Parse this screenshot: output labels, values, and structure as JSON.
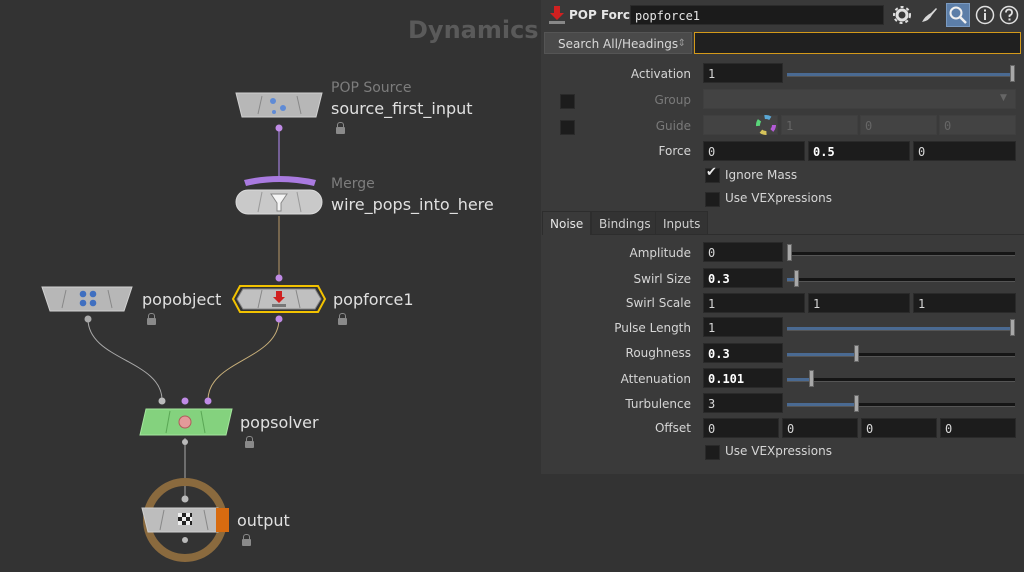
{
  "network": {
    "context_label": "Dynamics",
    "nodes": {
      "source": {
        "type": "POP Source",
        "name": "source_first_input"
      },
      "merge": {
        "type": "Merge",
        "name": "wire_pops_into_here"
      },
      "popobject": {
        "name": "popobject"
      },
      "popforce": {
        "name": "popforce1"
      },
      "popsolver": {
        "name": "popsolver"
      },
      "output": {
        "name": "output"
      }
    }
  },
  "panel": {
    "title": {
      "type_label": "POP Force",
      "node_name": "popforce1"
    },
    "search": {
      "label": "Search All/Headings",
      "value": ""
    },
    "params": {
      "activation": {
        "label": "Activation",
        "value": "1",
        "slider_fraction": 1.0
      },
      "group": {
        "label": "Group",
        "value": ""
      },
      "guide": {
        "label": "Guide",
        "values": [
          "1",
          "0",
          "0"
        ]
      },
      "force": {
        "label": "Force",
        "values": [
          "0",
          "0.5",
          "0"
        ]
      },
      "ignore_mass": {
        "label": "Ignore Mass",
        "checked": true
      },
      "use_vex_top": {
        "label": "Use VEXpressions",
        "checked": false
      }
    },
    "tabs": [
      "Noise",
      "Bindings",
      "Inputs"
    ],
    "noise": {
      "amplitude": {
        "label": "Amplitude",
        "value": "0",
        "slider_fraction": 0.0
      },
      "swirl_size": {
        "label": "Swirl Size",
        "value": "0.3",
        "slider_fraction": 0.03
      },
      "swirl_scale": {
        "label": "Swirl Scale",
        "values": [
          "1",
          "1",
          "1"
        ]
      },
      "pulse_length": {
        "label": "Pulse Length",
        "value": "1",
        "slider_fraction": 1.0
      },
      "roughness": {
        "label": "Roughness",
        "value": "0.3",
        "slider_fraction": 0.3
      },
      "attenuation": {
        "label": "Attenuation",
        "value": "0.101",
        "slider_fraction": 0.1
      },
      "turbulence": {
        "label": "Turbulence",
        "value": "3",
        "slider_fraction": 0.3
      },
      "offset": {
        "label": "Offset",
        "values": [
          "0",
          "0",
          "0",
          "0"
        ]
      },
      "use_vex": {
        "label": "Use VEXpressions",
        "checked": false
      }
    }
  }
}
